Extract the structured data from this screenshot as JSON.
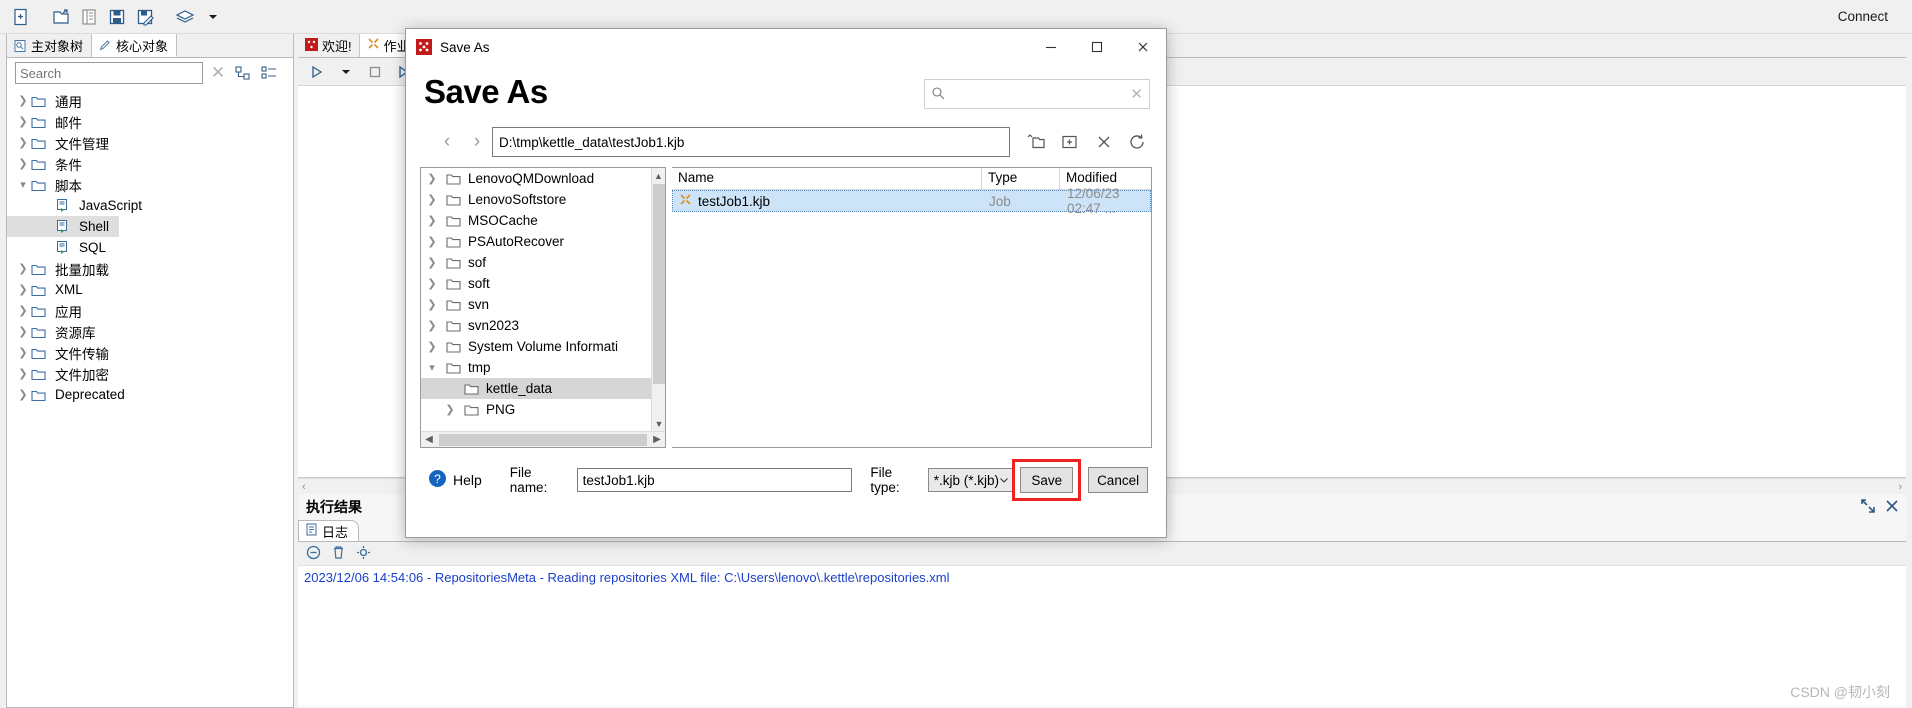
{
  "toolbar": {
    "buttons": [
      {
        "name": "new-file-icon",
        "title": "新建"
      },
      {
        "name": "open-file-icon",
        "title": "打开"
      },
      {
        "name": "explore-icon",
        "title": "浏览"
      },
      {
        "name": "save-icon",
        "title": "保存"
      },
      {
        "name": "save-as-icon",
        "title": "另存为"
      },
      {
        "name": "layers-icon",
        "title": "层"
      },
      {
        "name": "chevron-down-icon",
        "title": "更多"
      }
    ],
    "connect_label": "Connect"
  },
  "sidebar": {
    "tabs": [
      {
        "label": "主对象树",
        "icon": "tree-view-icon",
        "active": false
      },
      {
        "label": "核心对象",
        "icon": "pencil-icon",
        "active": true
      }
    ],
    "search": {
      "value": "",
      "placeholder": "Search"
    },
    "tools": [
      {
        "name": "collapse-all-icon"
      },
      {
        "name": "expand-all-icon"
      }
    ],
    "tree": [
      {
        "label": "通用",
        "type": "folder",
        "state": "collapsed",
        "level": 1
      },
      {
        "label": "邮件",
        "type": "folder",
        "state": "collapsed",
        "level": 1
      },
      {
        "label": "文件管理",
        "type": "folder",
        "state": "collapsed",
        "level": 1
      },
      {
        "label": "条件",
        "type": "folder",
        "state": "collapsed",
        "level": 1
      },
      {
        "label": "脚本",
        "type": "folder",
        "state": "expanded",
        "level": 1
      },
      {
        "label": "JavaScript",
        "type": "script",
        "state": "leaf",
        "level": 2
      },
      {
        "label": "Shell",
        "type": "script",
        "state": "leaf",
        "level": 2,
        "selected": true
      },
      {
        "label": "SQL",
        "type": "script",
        "state": "leaf",
        "level": 2
      },
      {
        "label": "批量加载",
        "type": "folder",
        "state": "collapsed",
        "level": 1
      },
      {
        "label": "XML",
        "type": "folder",
        "state": "collapsed",
        "level": 1
      },
      {
        "label": "应用",
        "type": "folder",
        "state": "collapsed",
        "level": 1
      },
      {
        "label": "资源库",
        "type": "folder",
        "state": "collapsed",
        "level": 1
      },
      {
        "label": "文件传输",
        "type": "folder",
        "state": "collapsed",
        "level": 1
      },
      {
        "label": "文件加密",
        "type": "folder",
        "state": "collapsed",
        "level": 1
      },
      {
        "label": "Deprecated",
        "type": "folder",
        "state": "collapsed",
        "level": 1
      }
    ]
  },
  "editor": {
    "tabs": [
      {
        "label": "欢迎!",
        "icon": "kettle-icon",
        "active": false
      },
      {
        "label": "作业",
        "icon": "job-icon",
        "active": true
      }
    ],
    "toolbar": [
      {
        "name": "run-icon"
      },
      {
        "name": "chevron-down-icon"
      },
      {
        "name": "stop-icon"
      },
      {
        "name": "debug-icon"
      },
      {
        "name": "preview-icon"
      }
    ]
  },
  "results": {
    "title": "执行结果",
    "tabs": [
      {
        "label": "日志",
        "icon": "log-icon",
        "active": true
      }
    ],
    "log_toolbar": [
      {
        "name": "minus-icon"
      },
      {
        "name": "trash-icon"
      },
      {
        "name": "settings-icon"
      }
    ],
    "log_lines": [
      "2023/12/06 14:54:06 - RepositoriesMeta - Reading repositories XML file: C:\\Users\\lenovo\\.kettle\\repositories.xml"
    ],
    "corner_icons": [
      {
        "name": "maximize-icon"
      },
      {
        "name": "close-icon"
      }
    ]
  },
  "dialog": {
    "titlebar": {
      "icon": "kettle-icon",
      "title": "Save As",
      "minimize": "—",
      "maximize": "□",
      "close": "✕"
    },
    "heading": "Save As",
    "search": {
      "value": "",
      "placeholder": "",
      "icon": "search-icon",
      "clear_icon": "clear-icon"
    },
    "nav": {
      "back": "‹",
      "forward": "›"
    },
    "path": {
      "value": "D:\\tmp\\kettle_data\\testJob1.kjb"
    },
    "path_tools": [
      {
        "name": "up-folder-icon"
      },
      {
        "name": "new-folder-icon"
      },
      {
        "name": "delete-icon"
      },
      {
        "name": "refresh-icon"
      }
    ],
    "folder_tree": [
      {
        "label": "LenovoQMDownload",
        "state": "collapsed",
        "level": 1
      },
      {
        "label": "LenovoSoftstore",
        "state": "collapsed",
        "level": 1
      },
      {
        "label": "MSOCache",
        "state": "collapsed",
        "level": 1
      },
      {
        "label": "PSAutoRecover",
        "state": "collapsed",
        "level": 1
      },
      {
        "label": "sof",
        "state": "collapsed",
        "level": 1
      },
      {
        "label": "soft",
        "state": "collapsed",
        "level": 1
      },
      {
        "label": "svn",
        "state": "collapsed",
        "level": 1
      },
      {
        "label": "svn2023",
        "state": "collapsed",
        "level": 1
      },
      {
        "label": "System Volume Informati",
        "state": "collapsed",
        "level": 1
      },
      {
        "label": "tmp",
        "state": "expanded",
        "level": 1
      },
      {
        "label": "kettle_data",
        "state": "leaf",
        "level": 2,
        "selected": true
      },
      {
        "label": "PNG",
        "state": "collapsed",
        "level": 2
      }
    ],
    "file_list": {
      "columns": [
        "Name",
        "Type",
        "Modified"
      ],
      "rows": [
        {
          "name": "testJob1.kjb",
          "type": "Job",
          "modified": "12/06/23 02:47 ...",
          "selected": true,
          "icon": "job-icon"
        }
      ]
    },
    "footer": {
      "help_label": "Help",
      "help_icon": "help-icon",
      "filename_label": "File name:",
      "filename_value": "testJob1.kjb",
      "filetype_label": "File type:",
      "filetype_value": "*.kjb (*.kjb)",
      "save_label": "Save",
      "cancel_label": "Cancel",
      "save_highlighted": true
    }
  },
  "watermark": "CSDN @韧小刻",
  "colors": {
    "accent": "#1b3fcc",
    "selection": "#cde3f7",
    "highlight_box": "#ee2222",
    "folder_outline": "#3c6ea5"
  }
}
